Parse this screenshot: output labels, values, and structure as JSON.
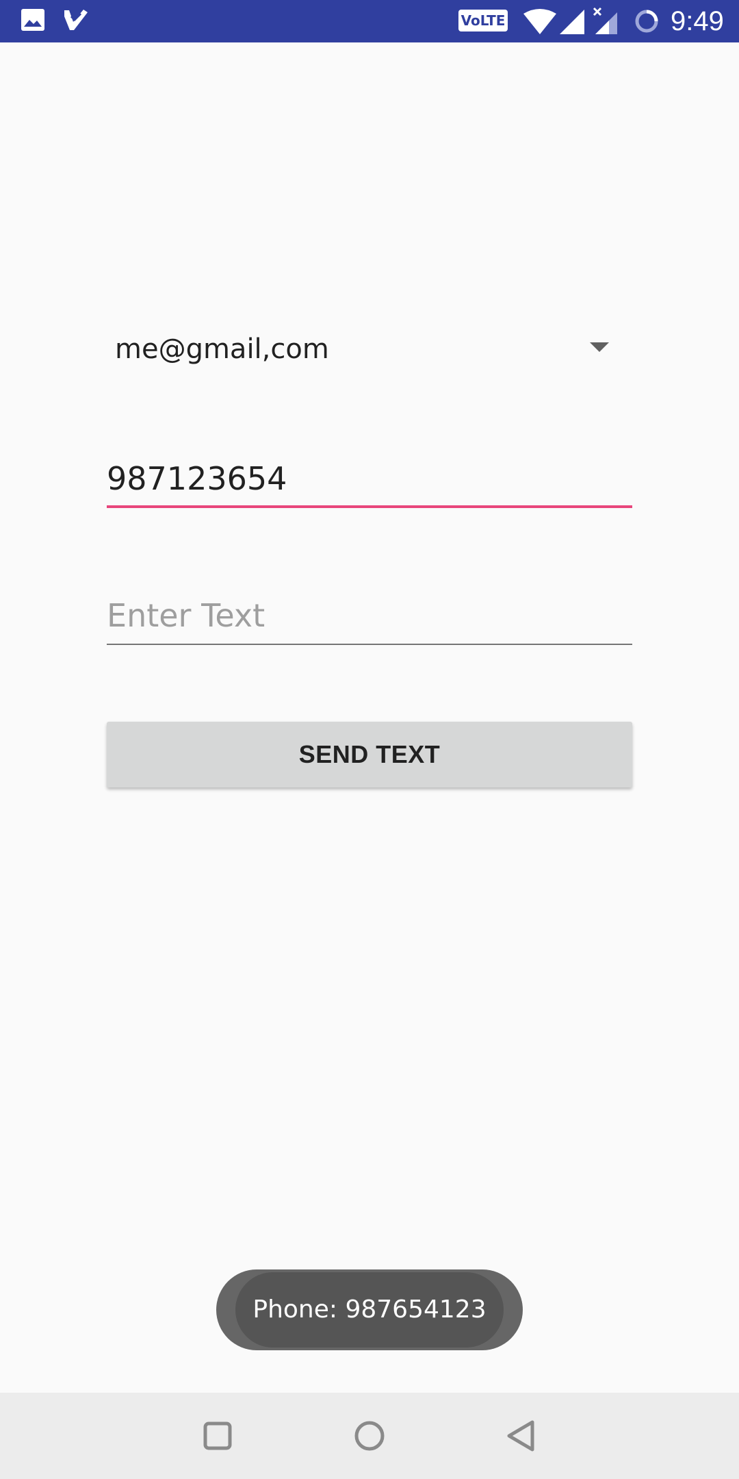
{
  "status_bar": {
    "time": "9:49",
    "volte_label": "VoLTE",
    "icons": [
      "gallery-icon",
      "check-icon",
      "volte-icon",
      "wifi-icon",
      "signal-icon",
      "signal-x-icon",
      "loading-icon"
    ]
  },
  "form": {
    "account_spinner": {
      "selected": "me@gmail,com"
    },
    "phone_field": {
      "value": "987123654",
      "placeholder": ""
    },
    "text_field": {
      "value": "",
      "placeholder": "Enter Text"
    },
    "send_button_label": "SEND TEXT"
  },
  "toast": {
    "message": "Phone: 987654123"
  },
  "nav_bar": {
    "buttons": [
      "recents",
      "home",
      "back"
    ]
  },
  "colors": {
    "status_bar": "#303f9f",
    "accent": "#e8467c",
    "button": "#d6d7d7",
    "toast": "#555555"
  }
}
